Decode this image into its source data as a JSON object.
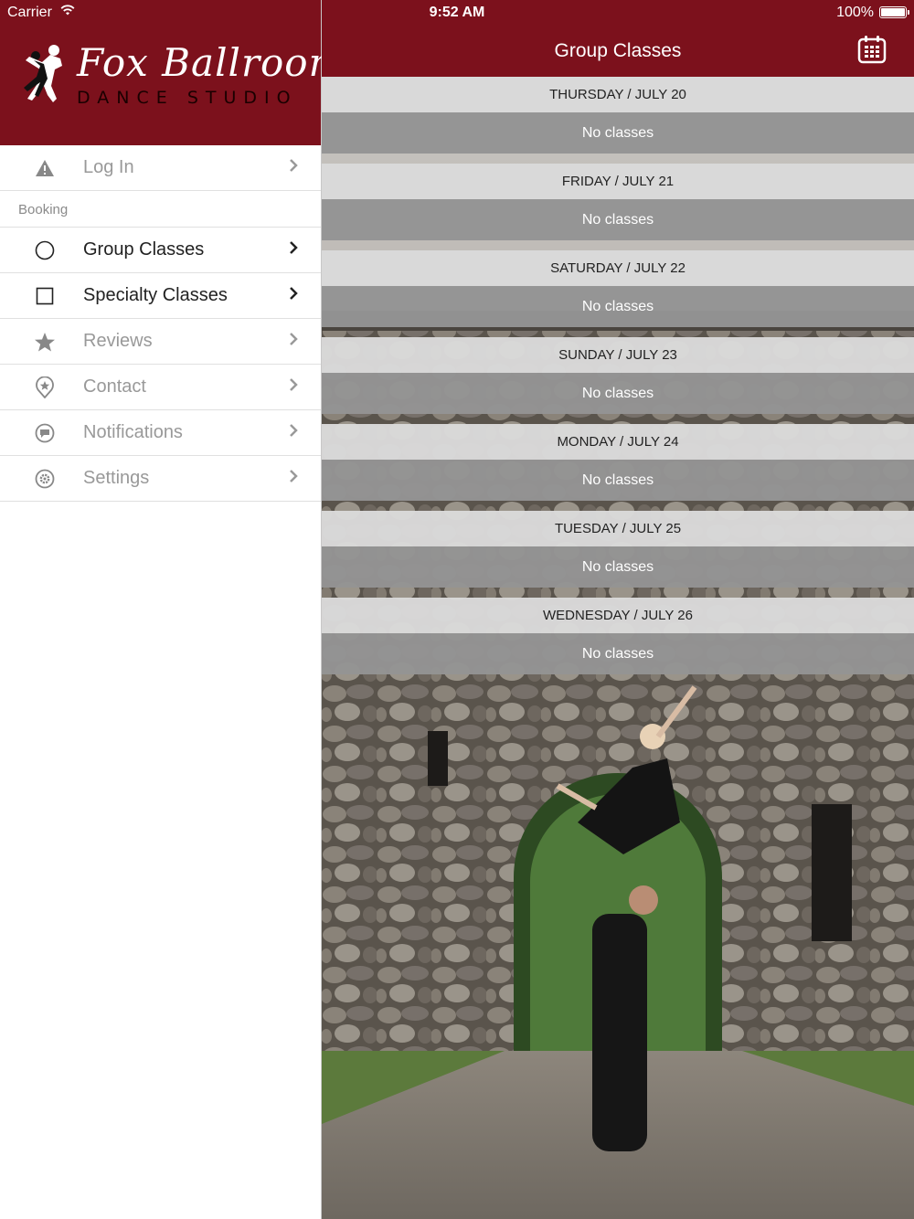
{
  "status_bar": {
    "carrier": "Carrier",
    "time": "9:52 AM",
    "battery": "100%"
  },
  "sidebar": {
    "logo": {
      "script": "Fox Ballroom",
      "subtitle": "DANCE STUDIO"
    },
    "login": {
      "label": "Log In",
      "icon": "warning-icon"
    },
    "section": "Booking",
    "items": [
      {
        "label": "Group Classes",
        "icon": "circle-icon",
        "active": true
      },
      {
        "label": "Specialty Classes",
        "icon": "square-icon",
        "active": true
      },
      {
        "label": "Reviews",
        "icon": "star-icon",
        "active": false
      },
      {
        "label": "Contact",
        "icon": "location-pin-icon",
        "active": false
      },
      {
        "label": "Notifications",
        "icon": "chat-bubble-icon",
        "active": false
      },
      {
        "label": "Settings",
        "icon": "gear-icon",
        "active": false
      }
    ]
  },
  "main": {
    "title": "Group Classes",
    "calendar_icon": "calendar-icon",
    "days": [
      {
        "header": "THURSDAY / JULY 20",
        "body": "No classes"
      },
      {
        "header": "FRIDAY / JULY 21",
        "body": "No classes"
      },
      {
        "header": "SATURDAY / JULY 22",
        "body": "No classes"
      },
      {
        "header": "SUNDAY / JULY 23",
        "body": "No classes"
      },
      {
        "header": "MONDAY / JULY 24",
        "body": "No classes"
      },
      {
        "header": "TUESDAY / JULY 25",
        "body": "No classes"
      },
      {
        "header": "WEDNESDAY / JULY 26",
        "body": "No classes"
      }
    ]
  },
  "colors": {
    "brand": "#7c111c",
    "day_header_bg": "#dadada",
    "day_body_bg": "#949494"
  }
}
